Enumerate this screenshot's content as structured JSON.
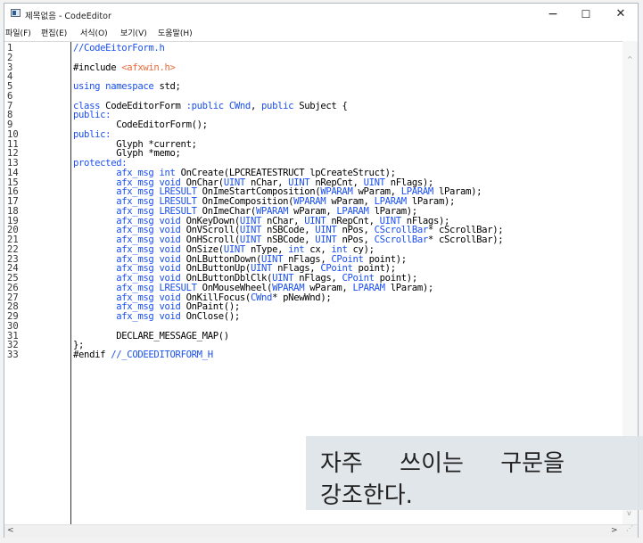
{
  "window": {
    "title": "제목없음 - CodeEditor",
    "minimize_glyph": "−",
    "maximize_glyph": "☐",
    "close_glyph": "✕"
  },
  "menu": {
    "items": [
      "파일(F)",
      "편집(E)",
      "서식(O)",
      "보기(V)",
      "도움말(H)"
    ]
  },
  "editor": {
    "lines": [
      [
        {
          "t": "//CodeEitorForm.h",
          "c": "cm"
        }
      ],
      [],
      [
        {
          "t": "#include "
        },
        {
          "t": "<afxwin.h>",
          "c": "inc"
        }
      ],
      [],
      [
        {
          "t": "using namespace",
          "c": "kw"
        },
        {
          "t": " std;"
        }
      ],
      [],
      [
        {
          "t": "class",
          "c": "kw"
        },
        {
          "t": " CodeEditorForm "
        },
        {
          "t": ":public",
          "c": "kw"
        },
        {
          "t": " "
        },
        {
          "t": "CWnd",
          "c": "typ"
        },
        {
          "t": ", "
        },
        {
          "t": "public",
          "c": "kw"
        },
        {
          "t": " Subject {"
        }
      ],
      [
        {
          "t": "public:",
          "c": "kw"
        }
      ],
      [
        {
          "t": "        CodeEditorForm();"
        }
      ],
      [
        {
          "t": "public:",
          "c": "kw"
        }
      ],
      [
        {
          "t": "        Glyph *current;"
        }
      ],
      [
        {
          "t": "        Glyph *memo;"
        }
      ],
      [
        {
          "t": "protected:",
          "c": "kw"
        }
      ],
      [
        {
          "t": "        afx_msg",
          "c": "kw"
        },
        {
          "t": " "
        },
        {
          "t": "int",
          "c": "kw"
        },
        {
          "t": " OnCreate(LPCREATESTRUCT lpCreateStruct);"
        }
      ],
      [
        {
          "t": "        afx_msg",
          "c": "kw"
        },
        {
          "t": " "
        },
        {
          "t": "void",
          "c": "kw"
        },
        {
          "t": " OnChar("
        },
        {
          "t": "UINT",
          "c": "typ"
        },
        {
          "t": " nChar, "
        },
        {
          "t": "UINT",
          "c": "typ"
        },
        {
          "t": " nRepCnt, "
        },
        {
          "t": "UINT",
          "c": "typ"
        },
        {
          "t": " nFlags);"
        }
      ],
      [
        {
          "t": "        afx_msg",
          "c": "kw"
        },
        {
          "t": " "
        },
        {
          "t": "LRESULT",
          "c": "kw"
        },
        {
          "t": " OnImeStartComposition("
        },
        {
          "t": "WPARAM",
          "c": "typ"
        },
        {
          "t": " wParam, "
        },
        {
          "t": "LPARAM",
          "c": "typ"
        },
        {
          "t": " lParam);"
        }
      ],
      [
        {
          "t": "        afx_msg",
          "c": "kw"
        },
        {
          "t": " "
        },
        {
          "t": "LRESULT",
          "c": "kw"
        },
        {
          "t": " OnImeComposition("
        },
        {
          "t": "WPARAM",
          "c": "typ"
        },
        {
          "t": " wParam, "
        },
        {
          "t": "LPARAM",
          "c": "typ"
        },
        {
          "t": " lParam);"
        }
      ],
      [
        {
          "t": "        afx_msg",
          "c": "kw"
        },
        {
          "t": " "
        },
        {
          "t": "LRESULT",
          "c": "kw"
        },
        {
          "t": " OnImeChar("
        },
        {
          "t": "WPARAM",
          "c": "typ"
        },
        {
          "t": " wParam, "
        },
        {
          "t": "LPARAM",
          "c": "typ"
        },
        {
          "t": " lParam);"
        }
      ],
      [
        {
          "t": "        afx_msg",
          "c": "kw"
        },
        {
          "t": " "
        },
        {
          "t": "void",
          "c": "kw"
        },
        {
          "t": " OnKeyDown("
        },
        {
          "t": "UINT",
          "c": "typ"
        },
        {
          "t": " nChar, "
        },
        {
          "t": "UINT",
          "c": "typ"
        },
        {
          "t": " nRepCnt, "
        },
        {
          "t": "UINT",
          "c": "typ"
        },
        {
          "t": " nFlags);"
        }
      ],
      [
        {
          "t": "        afx_msg",
          "c": "kw"
        },
        {
          "t": " "
        },
        {
          "t": "void",
          "c": "kw"
        },
        {
          "t": " OnVScroll("
        },
        {
          "t": "UINT",
          "c": "typ"
        },
        {
          "t": " nSBCode, "
        },
        {
          "t": "UINT",
          "c": "typ"
        },
        {
          "t": " nPos, "
        },
        {
          "t": "CScrollBar",
          "c": "typ"
        },
        {
          "t": "* cScrollBar);"
        }
      ],
      [
        {
          "t": "        afx_msg",
          "c": "kw"
        },
        {
          "t": " "
        },
        {
          "t": "void",
          "c": "kw"
        },
        {
          "t": " OnHScroll("
        },
        {
          "t": "UINT",
          "c": "typ"
        },
        {
          "t": " nSBCode, "
        },
        {
          "t": "UINT",
          "c": "typ"
        },
        {
          "t": " nPos, "
        },
        {
          "t": "CScrollBar",
          "c": "typ"
        },
        {
          "t": "* cScrollBar);"
        }
      ],
      [
        {
          "t": "        afx_msg",
          "c": "kw"
        },
        {
          "t": " "
        },
        {
          "t": "void",
          "c": "kw"
        },
        {
          "t": " OnSize("
        },
        {
          "t": "UINT",
          "c": "typ"
        },
        {
          "t": " nType, "
        },
        {
          "t": "int",
          "c": "kw"
        },
        {
          "t": " cx, "
        },
        {
          "t": "int",
          "c": "kw"
        },
        {
          "t": " cy);"
        }
      ],
      [
        {
          "t": "        afx_msg",
          "c": "kw"
        },
        {
          "t": " "
        },
        {
          "t": "void",
          "c": "kw"
        },
        {
          "t": " OnLButtonDown("
        },
        {
          "t": "UINT",
          "c": "typ"
        },
        {
          "t": " nFlags, "
        },
        {
          "t": "CPoint",
          "c": "typ"
        },
        {
          "t": " point);"
        }
      ],
      [
        {
          "t": "        afx_msg",
          "c": "kw"
        },
        {
          "t": " "
        },
        {
          "t": "void",
          "c": "kw"
        },
        {
          "t": " OnLButtonUp("
        },
        {
          "t": "UINT",
          "c": "typ"
        },
        {
          "t": " nFlags, "
        },
        {
          "t": "CPoint",
          "c": "typ"
        },
        {
          "t": " point);"
        }
      ],
      [
        {
          "t": "        afx_msg",
          "c": "kw"
        },
        {
          "t": " "
        },
        {
          "t": "void",
          "c": "kw"
        },
        {
          "t": " OnLButtonDblClk("
        },
        {
          "t": "UINT",
          "c": "typ"
        },
        {
          "t": " nFlags, "
        },
        {
          "t": "CPoint",
          "c": "typ"
        },
        {
          "t": " point);"
        }
      ],
      [
        {
          "t": "        afx_msg",
          "c": "kw"
        },
        {
          "t": " "
        },
        {
          "t": "LRESULT",
          "c": "kw"
        },
        {
          "t": " OnMouseWheel("
        },
        {
          "t": "WPARAM",
          "c": "typ"
        },
        {
          "t": " wParam, "
        },
        {
          "t": "LPARAM",
          "c": "typ"
        },
        {
          "t": " lParam);"
        }
      ],
      [
        {
          "t": "        afx_msg",
          "c": "kw"
        },
        {
          "t": " "
        },
        {
          "t": "void",
          "c": "kw"
        },
        {
          "t": " OnKillFocus("
        },
        {
          "t": "CWnd",
          "c": "typ"
        },
        {
          "t": "* pNewWnd);"
        }
      ],
      [
        {
          "t": "        afx_msg",
          "c": "kw"
        },
        {
          "t": " "
        },
        {
          "t": "void",
          "c": "kw"
        },
        {
          "t": " OnPaint();"
        }
      ],
      [
        {
          "t": "        afx_msg",
          "c": "kw"
        },
        {
          "t": " "
        },
        {
          "t": "void",
          "c": "kw"
        },
        {
          "t": " OnClose();"
        }
      ],
      [],
      [
        {
          "t": "        DECLARE_MESSAGE_MAP()"
        }
      ],
      [
        {
          "t": "};"
        }
      ],
      [
        {
          "t": "#endif "
        },
        {
          "t": "//_CODEEDITORFORM_H",
          "c": "cm"
        }
      ]
    ]
  },
  "scrollbar": {
    "up_glyph": "^",
    "down_glyph": "v",
    "left_glyph": "<",
    "right_glyph": ">",
    "grip_glyph": "⋰"
  },
  "annotation": {
    "line1": "자주     쓰이는     구문을",
    "line2": "강조한다."
  },
  "colors": {
    "keyword": "#1a4ff0",
    "include_path": "#ee6a3a",
    "annotation_bg": "#dfe4ea"
  }
}
